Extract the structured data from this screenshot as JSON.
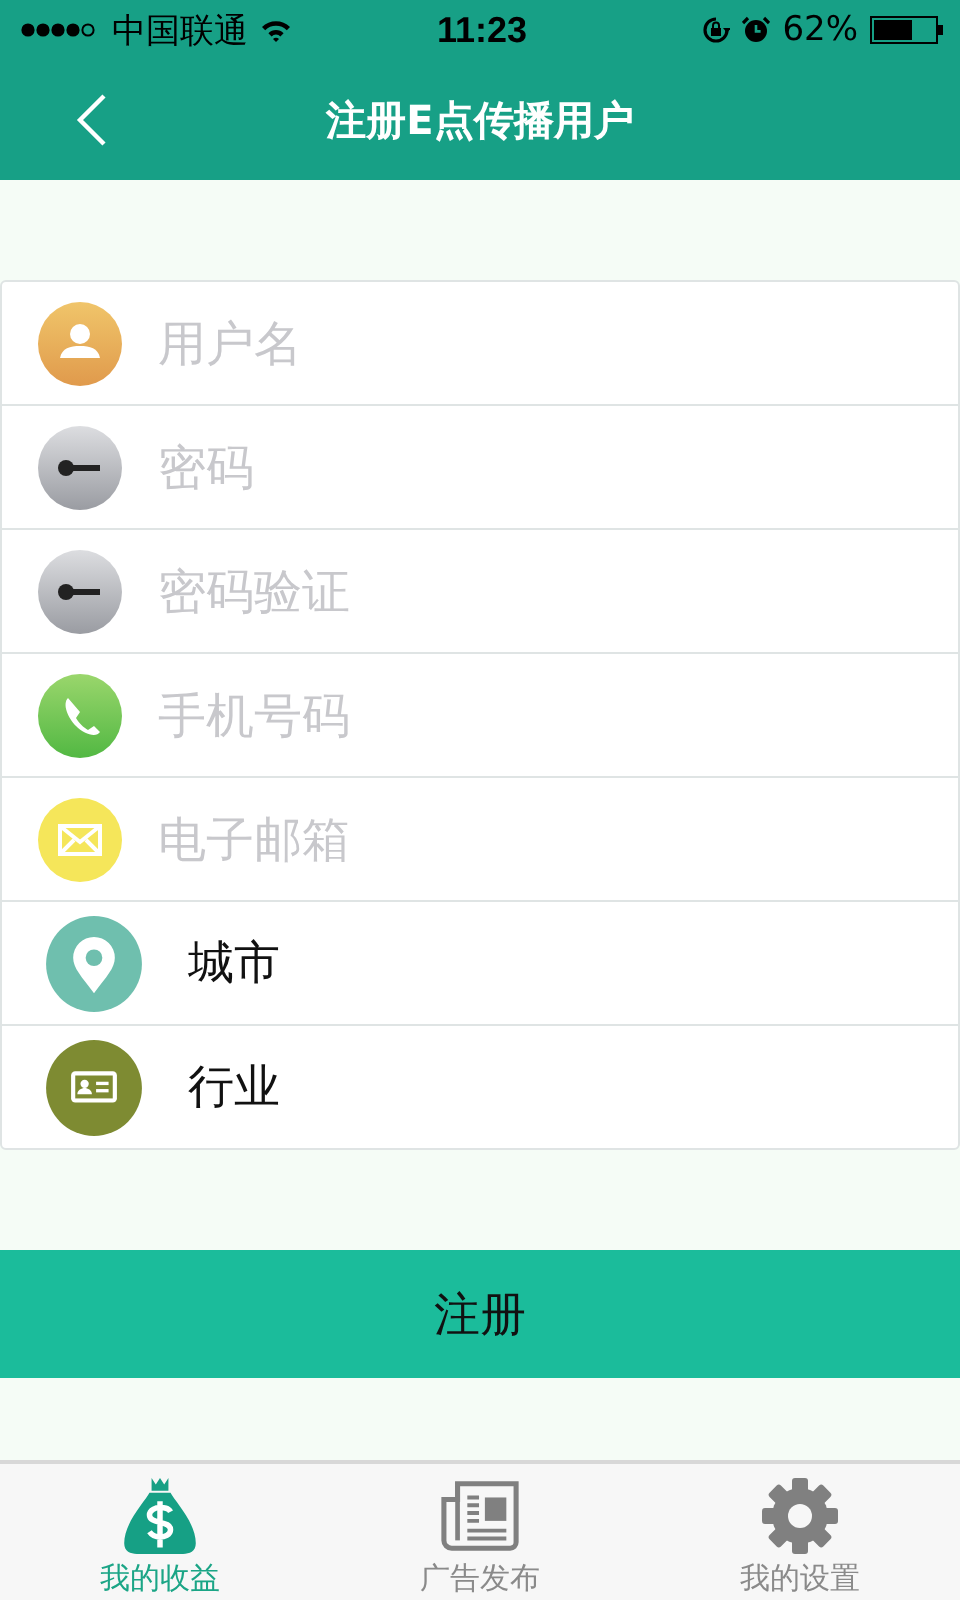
{
  "status_bar": {
    "carrier": "中国联通",
    "time": "11:23",
    "battery": "62%"
  },
  "nav": {
    "title": "注册E点传播用户"
  },
  "form": [
    {
      "kind": "input",
      "placeholder": "用户名"
    },
    {
      "kind": "input",
      "placeholder": "密码"
    },
    {
      "kind": "input",
      "placeholder": "密码验证"
    },
    {
      "kind": "input",
      "placeholder": "手机号码"
    },
    {
      "kind": "input",
      "placeholder": "电子邮箱"
    },
    {
      "kind": "select",
      "label": "城市"
    },
    {
      "kind": "select",
      "label": "行业"
    }
  ],
  "submit": {
    "label": "注册"
  },
  "tabs": [
    {
      "label": "我的收益",
      "selected": true
    },
    {
      "label": "广告发布",
      "selected": false
    },
    {
      "label": "我的设置",
      "selected": false
    }
  ]
}
